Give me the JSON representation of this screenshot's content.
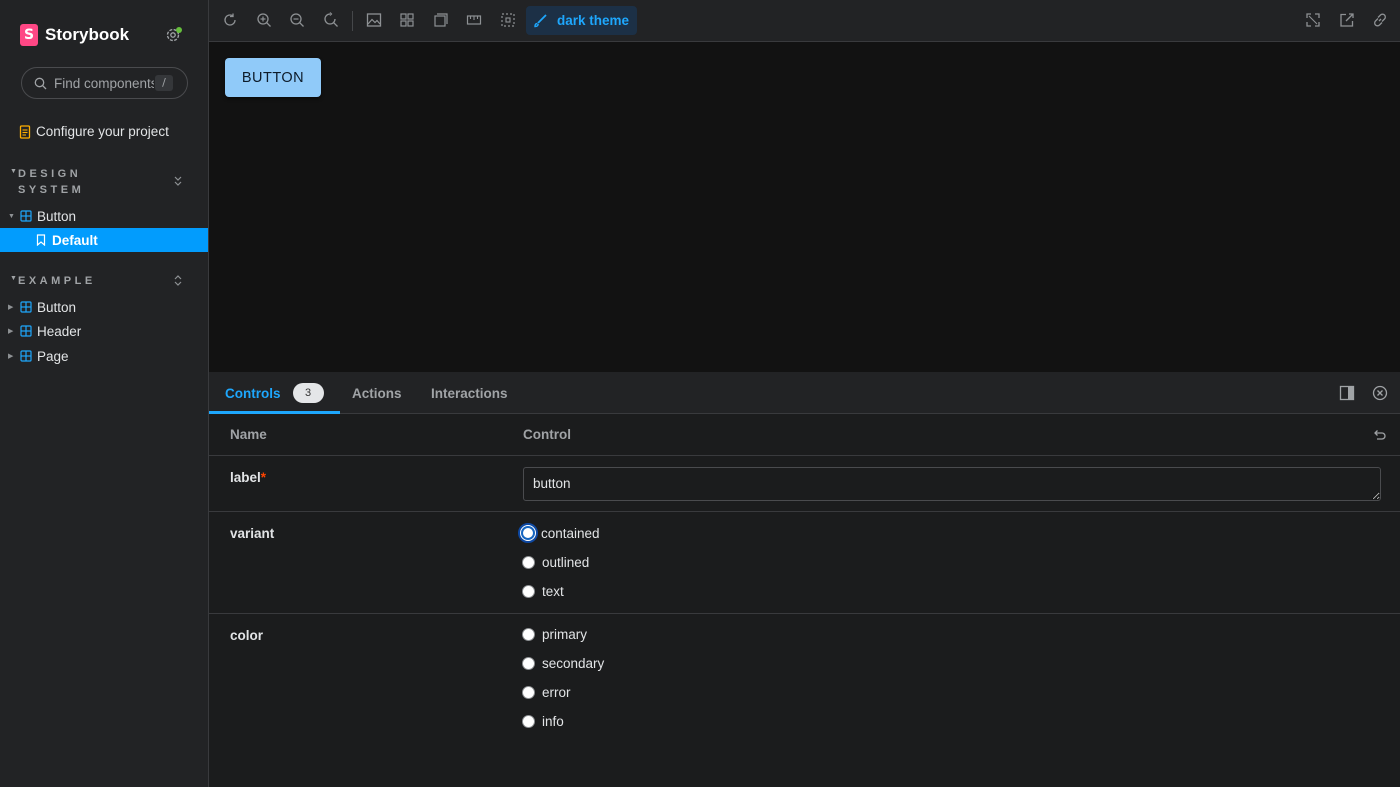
{
  "sidebar": {
    "brand": "Storybook",
    "search_placeholder": "Find components",
    "search_shortcut": "/",
    "configure_label": "Configure your project",
    "groups": [
      {
        "title": "DESIGN SYSTEM",
        "items": [
          {
            "label": "Button",
            "expanded": true
          },
          {
            "label": "Default",
            "selected": true
          }
        ]
      },
      {
        "title": "EXAMPLE",
        "items": [
          {
            "label": "Button"
          },
          {
            "label": "Header"
          },
          {
            "label": "Page"
          }
        ]
      }
    ]
  },
  "toolbar": {
    "theme_label": "dark theme"
  },
  "preview": {
    "button_label": "BUTTON"
  },
  "panel": {
    "tabs": [
      {
        "label": "Controls",
        "badge": "3",
        "active": true
      },
      {
        "label": "Actions"
      },
      {
        "label": "Interactions"
      }
    ],
    "headers": {
      "name": "Name",
      "control": "Control"
    },
    "rows": {
      "label": {
        "name": "label",
        "required_mark": "*",
        "value": "button"
      },
      "variant": {
        "name": "variant",
        "options": [
          "contained",
          "outlined",
          "text"
        ],
        "focused": "contained"
      },
      "color": {
        "name": "color",
        "options": [
          "primary",
          "secondary",
          "error",
          "info"
        ]
      }
    }
  },
  "colors": {
    "accent": "#1ea7fd",
    "selected_bg": "#029cfd",
    "brand_pink": "#ff4785",
    "status_dot": "#66bf3c",
    "preview_button": "#90caf9"
  }
}
